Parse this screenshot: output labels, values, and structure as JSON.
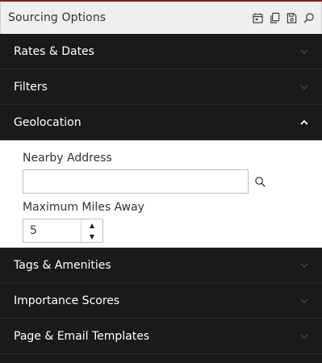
{
  "header": {
    "title": "Sourcing Options",
    "icons": [
      "calendar-icon",
      "copy-icon",
      "save-icon",
      "search-icon"
    ]
  },
  "sections": [
    {
      "label": "Rates & Dates",
      "expanded": false
    },
    {
      "label": "Filters",
      "expanded": false
    },
    {
      "label": "Geolocation",
      "expanded": true
    },
    {
      "label": "Tags & Amenities",
      "expanded": false
    },
    {
      "label": "Importance Scores",
      "expanded": false
    },
    {
      "label": "Page & Email Templates",
      "expanded": false
    }
  ],
  "geolocation": {
    "nearby_address_label": "Nearby Address",
    "nearby_address_value": "",
    "max_miles_label": "Maximum Miles Away",
    "max_miles_value": "5"
  },
  "colors": {
    "panel_bg": "#1b1a1b",
    "header_bg": "#efefef",
    "accent_top": "#7a1f1f"
  }
}
